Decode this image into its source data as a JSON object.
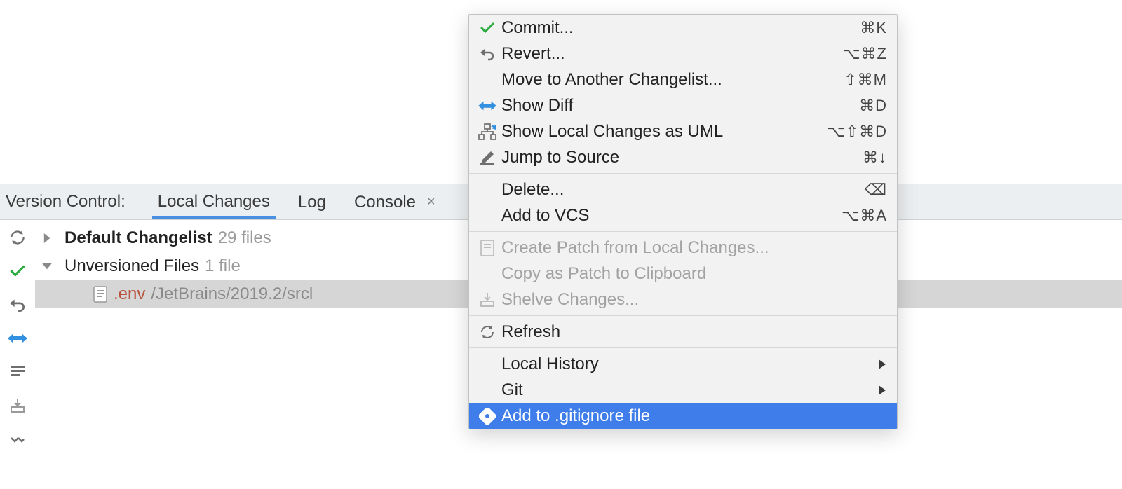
{
  "tabbar": {
    "title": "Version Control:",
    "tabs": [
      {
        "label": "Local Changes",
        "active": true
      },
      {
        "label": "Log",
        "active": false
      },
      {
        "label": "Console",
        "active": false,
        "closable": true
      }
    ]
  },
  "tree": {
    "changelist": {
      "name": "Default Changelist",
      "count": "29 files"
    },
    "unversioned": {
      "name": "Unversioned Files",
      "count": "1 file"
    },
    "file": {
      "name": ".env",
      "path": "/JetBrains/2019.2/srcl"
    }
  },
  "sideIcons": [
    "refresh-icon",
    "commit-check-icon",
    "revert-icon",
    "diff-icon",
    "changelist-icon",
    "shelve-icon",
    "expand-icon"
  ],
  "menu": [
    {
      "type": "item",
      "icon": "check",
      "label": "Commit...",
      "shortcut": "⌘K"
    },
    {
      "type": "item",
      "icon": "revert",
      "label": "Revert...",
      "shortcut": "⌥⌘Z"
    },
    {
      "type": "item",
      "icon": "",
      "label": "Move to Another Changelist...",
      "shortcut": "⇧⌘M"
    },
    {
      "type": "item",
      "icon": "diff",
      "label": "Show Diff",
      "shortcut": "⌘D"
    },
    {
      "type": "item",
      "icon": "uml",
      "label": "Show Local Changes as UML",
      "shortcut": "⌥⇧⌘D"
    },
    {
      "type": "item",
      "icon": "edit",
      "label": "Jump to Source",
      "shortcut": "⌘↓"
    },
    {
      "type": "sep"
    },
    {
      "type": "item",
      "icon": "",
      "label": "Delete...",
      "shortcut": "⌫"
    },
    {
      "type": "item",
      "icon": "",
      "label": "Add to VCS",
      "shortcut": "⌥⌘A"
    },
    {
      "type": "sep"
    },
    {
      "type": "item",
      "icon": "patch",
      "label": "Create Patch from Local Changes...",
      "shortcut": "",
      "disabled": true
    },
    {
      "type": "item",
      "icon": "",
      "label": "Copy as Patch to Clipboard",
      "shortcut": "",
      "disabled": true
    },
    {
      "type": "item",
      "icon": "shelve",
      "label": "Shelve Changes...",
      "shortcut": "",
      "disabled": true
    },
    {
      "type": "sep"
    },
    {
      "type": "item",
      "icon": "refresh",
      "label": "Refresh",
      "shortcut": ""
    },
    {
      "type": "sep"
    },
    {
      "type": "item",
      "icon": "",
      "label": "Local History",
      "submenu": true
    },
    {
      "type": "item",
      "icon": "",
      "label": "Git",
      "submenu": true
    },
    {
      "type": "item",
      "icon": "gitignore",
      "label": "Add to .gitignore file",
      "highlight": true
    }
  ]
}
